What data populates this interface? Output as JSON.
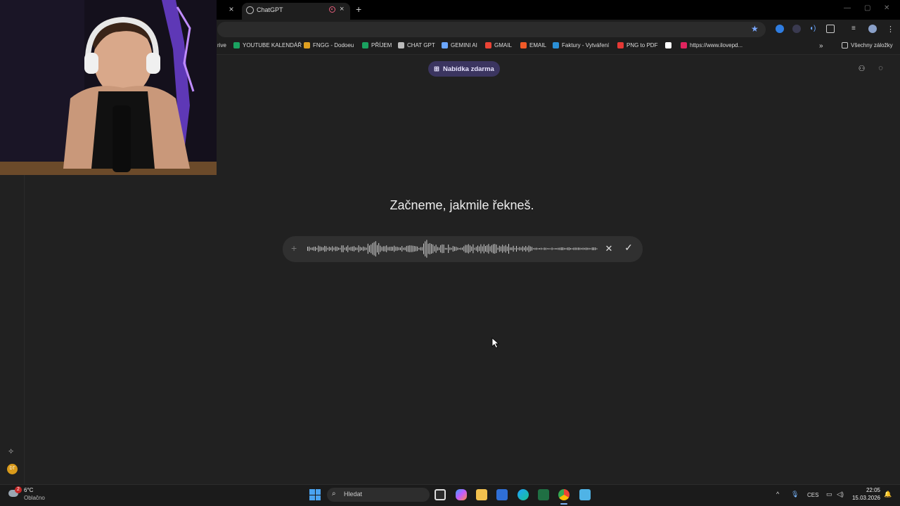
{
  "browser": {
    "tab_title": "ChatGPT",
    "new_tab": "+",
    "close_glyph": "×"
  },
  "bookmarks": [
    {
      "label": "rive",
      "icon": "drive-icon",
      "color": "#2f9e44"
    },
    {
      "label": "YOUTUBE KALENDÁŘ",
      "icon": "sheets-icon",
      "color": "#1aa260"
    },
    {
      "label": "FNGG - Dodoeu",
      "icon": "fngg-icon",
      "color": "#e0a020"
    },
    {
      "label": "PŘÍJEM",
      "icon": "sheets-icon",
      "color": "#1aa260"
    },
    {
      "label": "CHAT GPT",
      "icon": "chatgpt-icon",
      "color": "#bbbbbb"
    },
    {
      "label": "GEMINI AI",
      "icon": "gemini-icon",
      "color": "#6aa6ff"
    },
    {
      "label": "GMAIL",
      "icon": "gmail-icon",
      "color": "#ea4335"
    },
    {
      "label": "EMAIL",
      "icon": "email-icon",
      "color": "#f05a28"
    },
    {
      "label": "Faktury - Vytváření",
      "icon": "invoice-icon",
      "color": "#2b8fd6"
    },
    {
      "label": "PNG to PDF",
      "icon": "pdf-icon",
      "color": "#e53935"
    },
    {
      "label": "",
      "icon": "s-icon",
      "color": "#ffffff"
    },
    {
      "label": "https://www.ilovepd...",
      "icon": "heart-icon",
      "color": "#e0245e"
    }
  ],
  "bookmarks_more": "»",
  "all_bookmarks": "Všechny záložky",
  "offer_button": "Nabídka zdarma",
  "heading": "Začneme, jakmile řekneš.",
  "composer": {
    "plus": "+",
    "cancel": "✕",
    "confirm": "✓"
  },
  "taskbar": {
    "weather_temp": "6°C",
    "weather_cond": "Oblačno",
    "weather_badge": "2",
    "search_placeholder": "Hledat",
    "language": "CES",
    "time": "22:05",
    "date": "15.03.2026"
  },
  "colors": {
    "background": "#212121",
    "composer": "#303030",
    "offer": "#3b3560",
    "accent": "#7aa7ff"
  }
}
